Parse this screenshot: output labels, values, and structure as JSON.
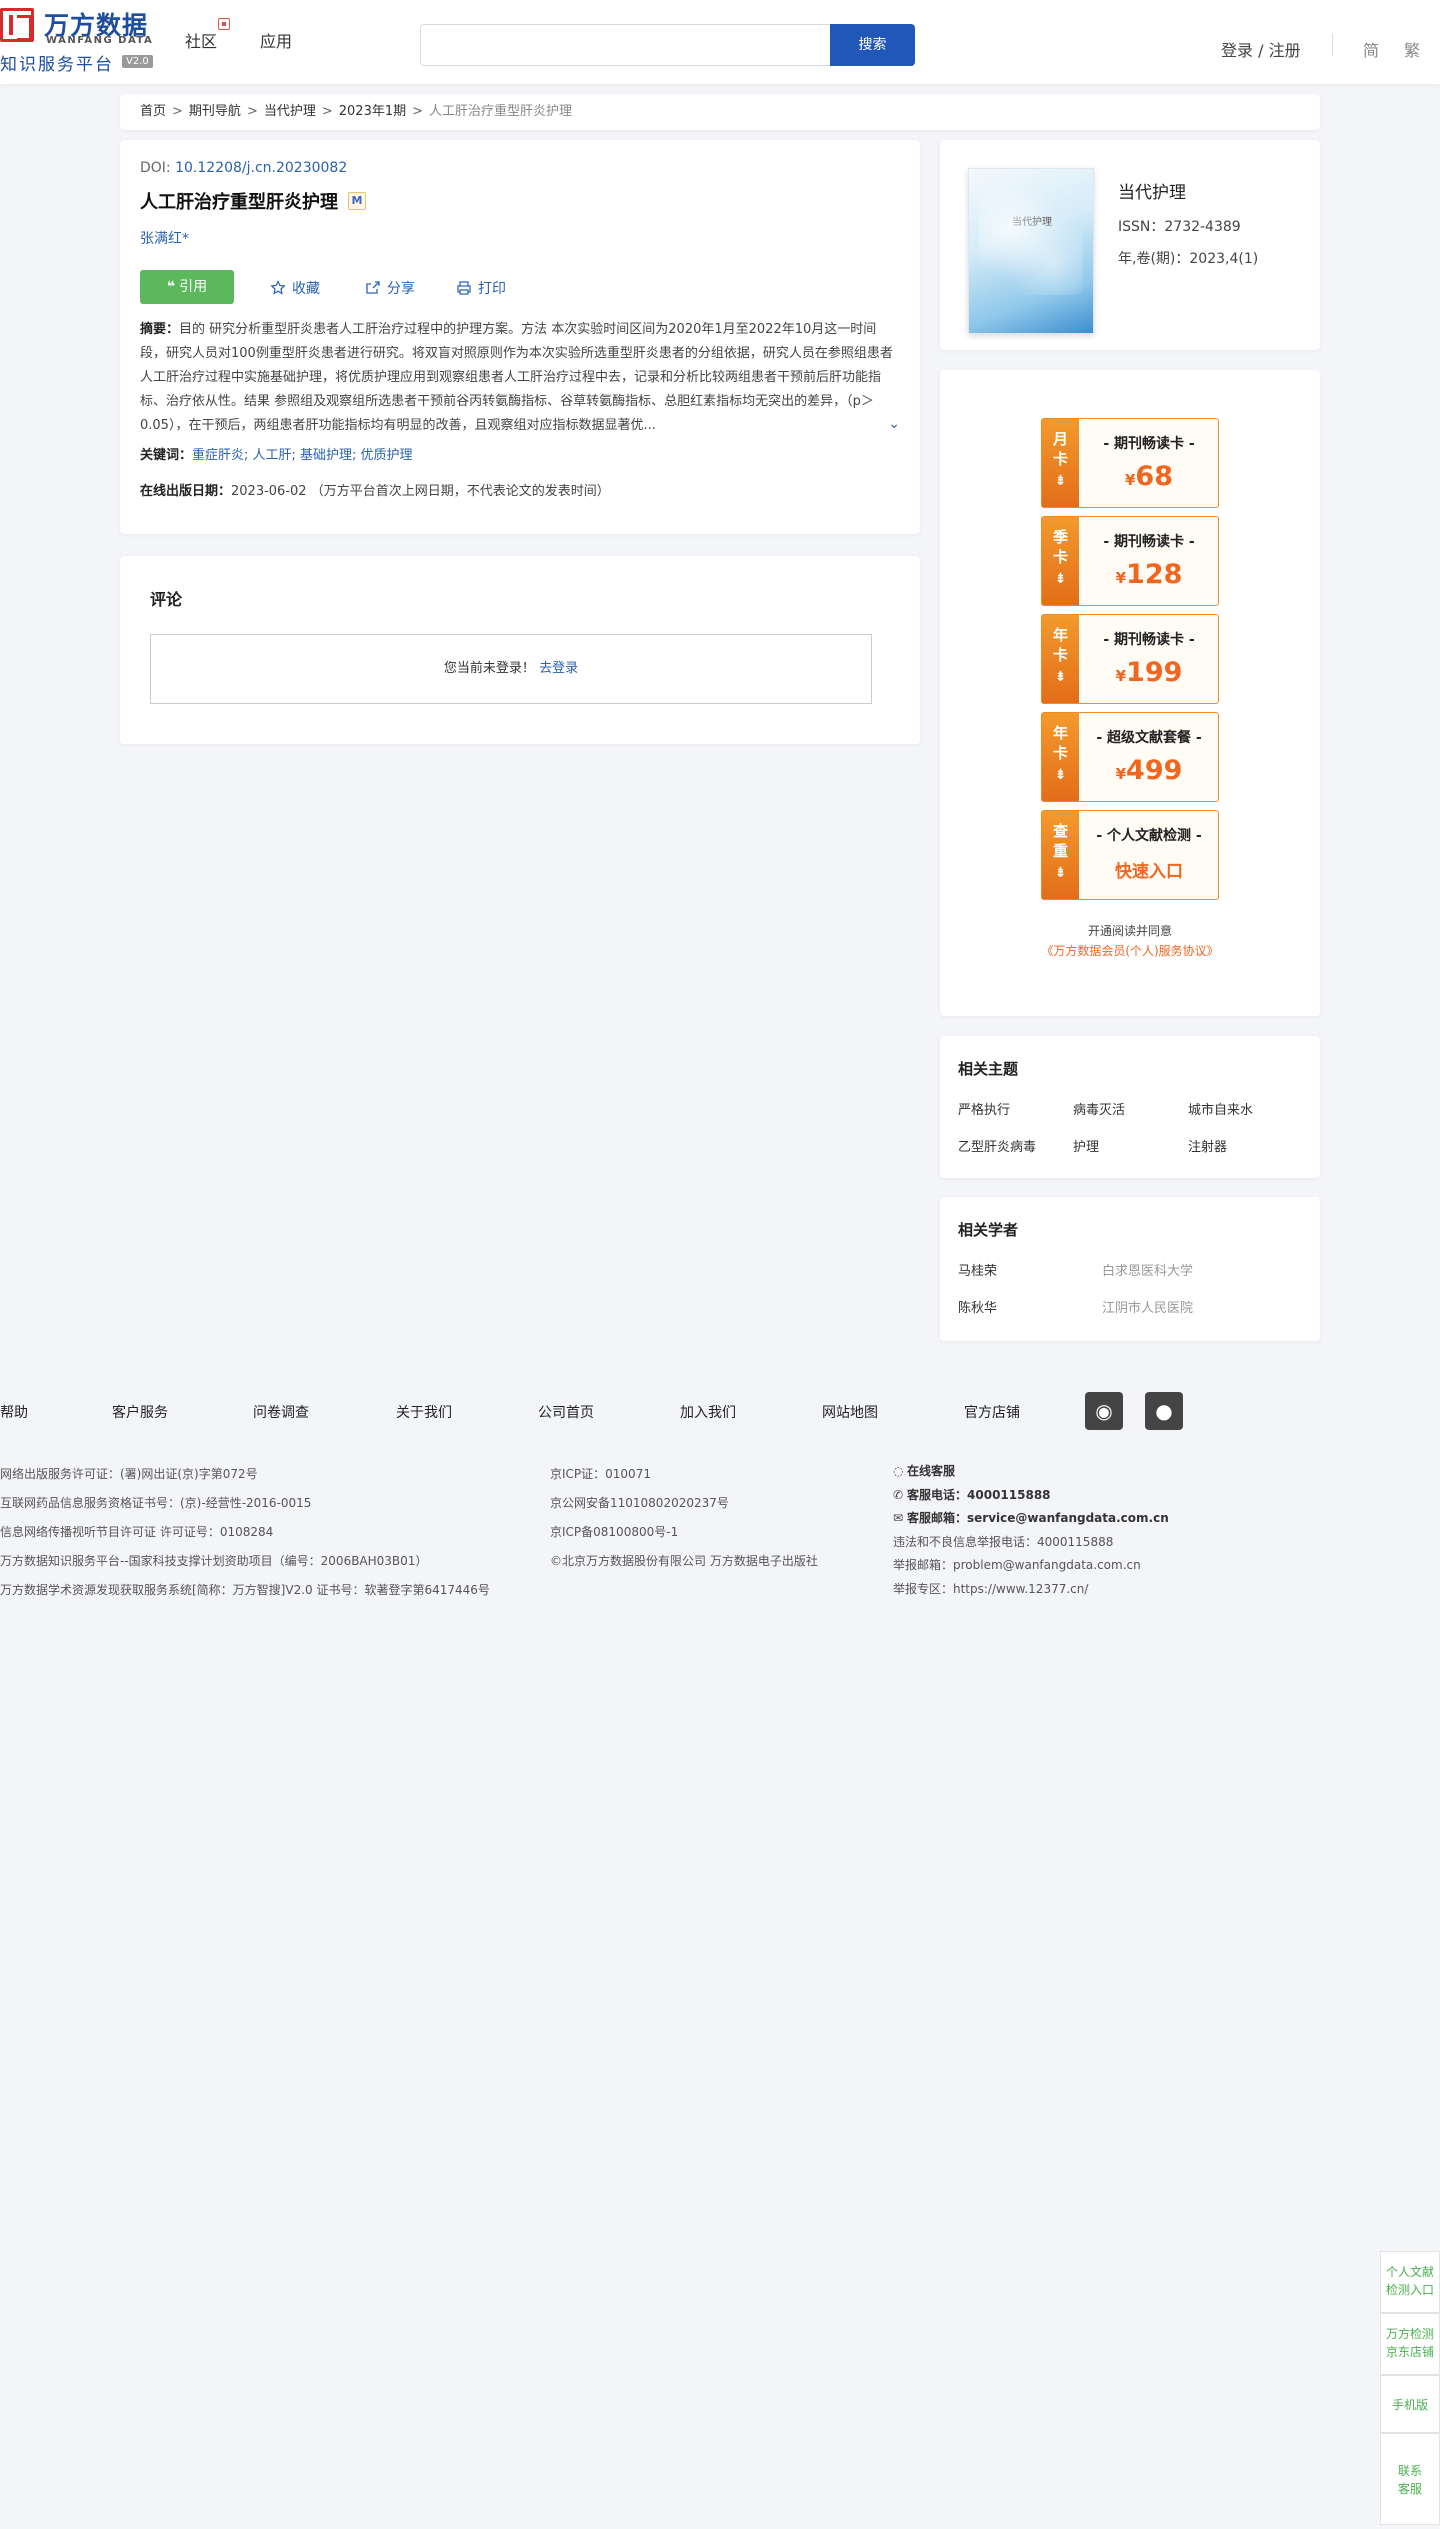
{
  "header": {
    "logo": {
      "name": "万方数据",
      "en": "WANFANG DATA",
      "subtitle": "知识服务平台",
      "version": "V2.0"
    },
    "nav": [
      {
        "label": "社区"
      },
      {
        "label": "应用"
      }
    ],
    "search": {
      "placeholder": "",
      "button": "搜索"
    },
    "login": "登录 / 注册",
    "lang_simplified": "简",
    "lang_traditional": "繁"
  },
  "breadcrumb": [
    "首页",
    "期刊导航",
    "当代护理",
    "2023年1期",
    "人工肝治疗重型肝炎护理"
  ],
  "article": {
    "doi_label": "DOI: ",
    "doi": "10.12208/j.cn.20230082",
    "title": "人工肝治疗重型肝炎护理",
    "title_badge": "M",
    "author": "张满红*",
    "actions": {
      "cite": "引用",
      "favorite": "收藏",
      "share": "分享",
      "print": "打印"
    },
    "abstract_label": "摘要：",
    "abstract": "目的 研究分析重型肝炎患者人工肝治疗过程中的护理方案。方法 本次实验时间区间为2020年1月至2022年10月这一时间段，研究人员对100例重型肝炎患者进行研究。将双盲对照原则作为本次实验所选重型肝炎患者的分组依据，研究人员在参照组患者人工肝治疗过程中实施基础护理，将优质护理应用到观察组患者人工肝治疗过程中去，记录和分析比较两组患者干预前后肝功能指标、治疗依从性。结果 参照组及观察组所选患者干预前谷丙转氨酶指标、谷草转氨酶指标、总胆红素指标均无突出的差异，（p＞0.05），在干预后，两组患者肝功能指标均有明显的改善，且观察组对应指标数据显著优...",
    "keywords_label": "关键词：",
    "keywords": "重症肝炎; 人工肝; 基础护理; 优质护理",
    "pubdate_label": "在线出版日期：",
    "pubdate": "2023-06-02 （万方平台首次上网日期，不代表论文的发表时间）"
  },
  "comments": {
    "title": "评论",
    "notice": "您当前未登录！",
    "login_link": "去登录"
  },
  "journal": {
    "cover_title": "当代护理",
    "name": "当代护理",
    "issn": "ISSN：2732-4389",
    "volume": "年,卷(期)：2023,4(1)"
  },
  "offers": [
    {
      "tab": "月卡",
      "name": "- 期刊畅读卡 -",
      "currency": "¥",
      "price": "68"
    },
    {
      "tab": "季卡",
      "name": "- 期刊畅读卡 -",
      "currency": "¥",
      "price": "128"
    },
    {
      "tab": "年卡",
      "name": "- 期刊畅读卡 -",
      "currency": "¥",
      "price": "199"
    },
    {
      "tab": "年卡",
      "name": "- 超级文献套餐 -",
      "currency": "¥",
      "price": "499"
    },
    {
      "tab": "查重",
      "name": "- 个人文献检测 -",
      "entry": "快速入口"
    }
  ],
  "agreement": {
    "text": "开通阅读并同意",
    "link": "《万方数据会员(个人)服务协议》"
  },
  "topics": {
    "title": "相关主题",
    "items": [
      "严格执行",
      "病毒灭活",
      "城市自来水",
      "乙型肝炎病毒",
      "护理",
      "注射器"
    ]
  },
  "scholars": {
    "title": "相关学者",
    "items": [
      {
        "name": "马桂荣",
        "org": "白求恩医科大学"
      },
      {
        "name": "陈秋华",
        "org": "江阴市人民医院"
      }
    ]
  },
  "footer": {
    "nav": [
      "帮助",
      "客户服务",
      "问卷调查",
      "关于我们",
      "公司首页",
      "加入我们",
      "网站地图",
      "官方店铺"
    ],
    "col1": [
      "网络出版服务许可证：(署)网出证(京)字第072号",
      "互联网药品信息服务资格证书号：(京)-经营性-2016-0015",
      "信息网络传播视听节目许可证 许可证号：0108284",
      "万方数据知识服务平台--国家科技支撑计划资助项目（编号：2006BAH03B01）",
      "万方数据学术资源发现获取服务系统[简称：万方智搜]V2.0 证书号：软著登字第6417446号"
    ],
    "col2": [
      "京ICP证：010071",
      "京公网安备11010802020237号",
      "京ICP备08100800号-1",
      "©北京万方数据股份有限公司 万方数据电子出版社"
    ],
    "online_service": "在线客服",
    "phone_label": "客服电话：",
    "phone": "4000115888",
    "email_label": "客服邮箱：",
    "email": "service@wanfangdata.com.cn",
    "report_phone": "违法和不良信息举报电话：4000115888",
    "report_email": "举报邮箱：problem@wanfangdata.com.cn",
    "report_zone": "举报专区：https://www.12377.cn/"
  },
  "side": [
    {
      "line1": "个人文献",
      "line2": "检测入口"
    },
    {
      "line1": "万方检测",
      "line2": "京东店铺"
    },
    {
      "line1": "手机版"
    },
    {
      "line1": "联系",
      "line2": "客服"
    }
  ]
}
